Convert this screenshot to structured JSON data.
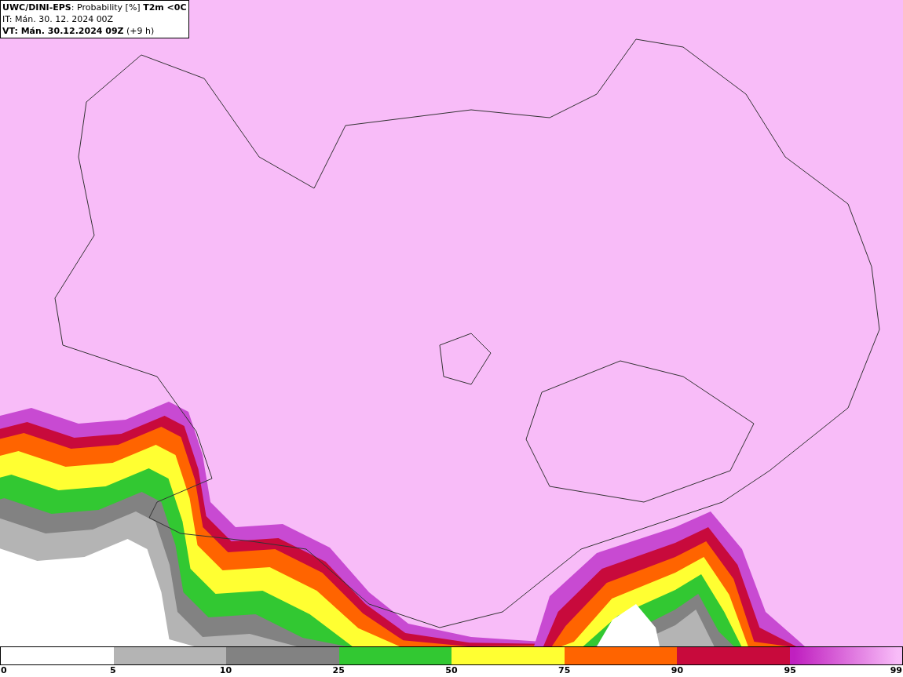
{
  "header": {
    "lines": [
      "**UWC/DINI-EPS**: Probability [%] **T2m <0C**",
      "IT: Mán. 30. 12. 2024 00Z",
      "**VT: Mán. 30.12.2024 09Z** (+9 h)"
    ]
  },
  "legend": {
    "segments": [
      {
        "kind": "solid",
        "color": "#ffffff"
      },
      {
        "kind": "solid",
        "color": "#b4b4b4"
      },
      {
        "kind": "solid",
        "color": "#828282"
      },
      {
        "kind": "solid",
        "color": "#32c832"
      },
      {
        "kind": "solid",
        "color": "#ffff32"
      },
      {
        "kind": "solid",
        "color": "#ff6400"
      },
      {
        "kind": "solid",
        "color": "#c80a3c"
      },
      {
        "kind": "gradient",
        "stops": [
          {
            "color": "#c020c0"
          },
          {
            "color": "#f8bcf8"
          }
        ]
      }
    ],
    "labels": [
      "0",
      "5",
      "10",
      "25",
      "50",
      "75",
      "90",
      "95",
      "99"
    ]
  }
}
